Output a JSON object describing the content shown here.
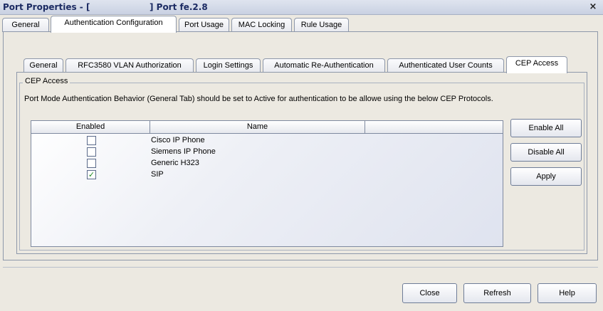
{
  "window": {
    "title": "Port Properties - [                    ] Port fe.2.8",
    "close_glyph": "×"
  },
  "outer_tabs": [
    {
      "label": "General",
      "active": false
    },
    {
      "label": "Authentication Configuration",
      "active": true
    },
    {
      "label": "Port Usage",
      "active": false
    },
    {
      "label": "MAC Locking",
      "active": false
    },
    {
      "label": "Rule Usage",
      "active": false
    }
  ],
  "inner_tabs": [
    {
      "label": "General",
      "active": false
    },
    {
      "label": "RFC3580 VLAN Authorization",
      "active": false
    },
    {
      "label": "Login Settings",
      "active": false
    },
    {
      "label": "Automatic Re-Authentication",
      "active": false
    },
    {
      "label": "Authenticated User Counts",
      "active": false
    },
    {
      "label": "CEP Access",
      "active": true
    }
  ],
  "cep_access": {
    "group_title": "CEP Access",
    "description": "Port Mode Authentication Behavior (General Tab) should be set to Active for authentication to be allowe  using the below CEP Protocols.",
    "table": {
      "columns": [
        "Enabled",
        "Name"
      ],
      "rows": [
        {
          "enabled": false,
          "name": "Cisco IP Phone"
        },
        {
          "enabled": false,
          "name": "Siemens IP Phone"
        },
        {
          "enabled": false,
          "name": "Generic H323"
        },
        {
          "enabled": true,
          "name": "SIP"
        }
      ]
    },
    "side_buttons": {
      "enable_all": "Enable All",
      "disable_all": "Disable All",
      "apply": "Apply"
    }
  },
  "footer_buttons": {
    "close": "Close",
    "refresh": "Refresh",
    "help": "Help"
  },
  "icons": {
    "checkmark": "✓"
  }
}
